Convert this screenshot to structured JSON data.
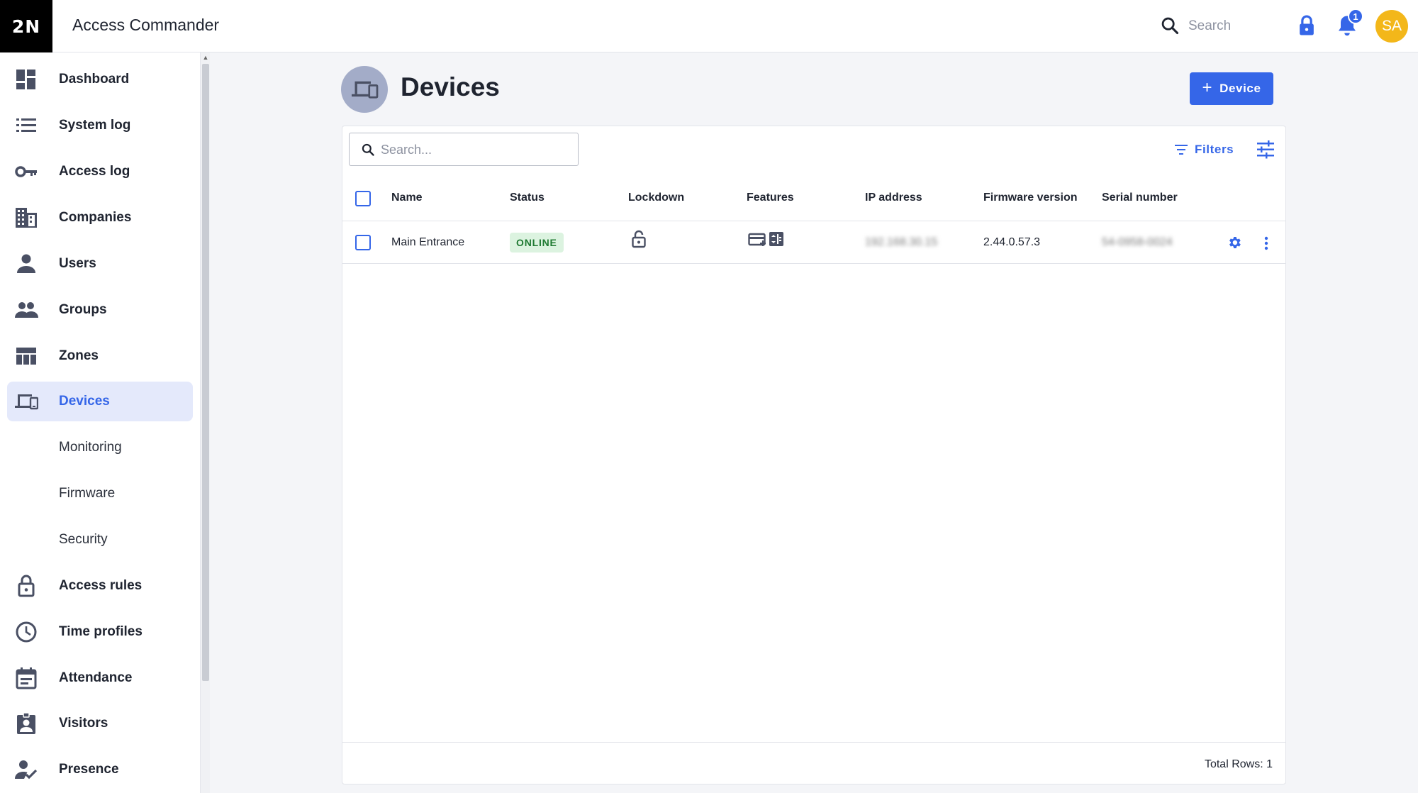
{
  "app": {
    "logo_text": "2N",
    "title": "Access Commander",
    "search_placeholder": "Search",
    "notification_count": "1",
    "avatar_initials": "SA",
    "accent_color": "#3566e8",
    "avatar_color": "#f3b71a"
  },
  "sidebar": {
    "items": [
      {
        "label": "Dashboard",
        "icon": "dashboard-icon"
      },
      {
        "label": "System log",
        "icon": "list-icon"
      },
      {
        "label": "Access log",
        "icon": "key-icon"
      },
      {
        "label": "Companies",
        "icon": "building-icon"
      },
      {
        "label": "Users",
        "icon": "person-icon"
      },
      {
        "label": "Groups",
        "icon": "people-icon"
      },
      {
        "label": "Zones",
        "icon": "zones-icon"
      },
      {
        "label": "Devices",
        "icon": "devices-icon",
        "active": true
      },
      {
        "label": "Monitoring"
      },
      {
        "label": "Firmware"
      },
      {
        "label": "Security"
      },
      {
        "label": "Access rules",
        "icon": "lock-open-icon"
      },
      {
        "label": "Time profiles",
        "icon": "clock-icon"
      },
      {
        "label": "Attendance",
        "icon": "calendar-icon"
      },
      {
        "label": "Visitors",
        "icon": "badge-icon"
      },
      {
        "label": "Presence",
        "icon": "person-check-icon"
      }
    ]
  },
  "page": {
    "title": "Devices",
    "add_button_label": "Device",
    "search_placeholder": "Search...",
    "filters_label": "Filters"
  },
  "table": {
    "columns": [
      "Name",
      "Status",
      "Lockdown",
      "Features",
      "IP address",
      "Firmware version",
      "Serial number"
    ],
    "rows": [
      {
        "name": "Main Entrance",
        "status": "ONLINE",
        "ip_address": "192.168.30.15",
        "firmware_version": "2.44.0.57.3",
        "serial_number": "54-0958-0024"
      }
    ],
    "total_rows": "Total Rows: 1"
  }
}
